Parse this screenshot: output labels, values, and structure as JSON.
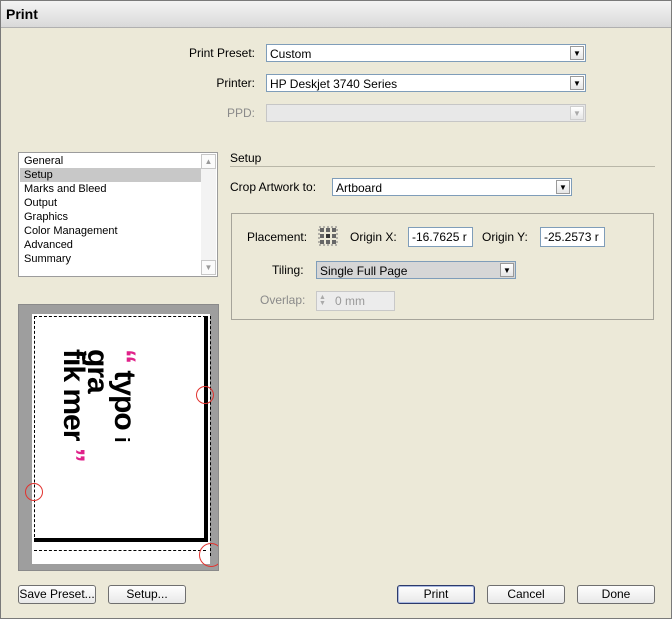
{
  "window": {
    "title": "Print"
  },
  "fields": {
    "print_preset": {
      "label": "Print Preset:",
      "value": "Custom"
    },
    "printer": {
      "label": "Printer:",
      "value": "HP Deskjet 3740 Series"
    },
    "ppd": {
      "label": "PPD:",
      "value": ""
    }
  },
  "sidebar": {
    "items": [
      "General",
      "Setup",
      "Marks and Bleed",
      "Output",
      "Graphics",
      "Color Management",
      "Advanced",
      "Summary"
    ],
    "selected": "Setup"
  },
  "setup": {
    "title": "Setup",
    "crop_artwork": {
      "label": "Crop Artwork to:",
      "value": "Artboard"
    },
    "placement": {
      "label": "Placement:"
    },
    "origin_x": {
      "label": "Origin X:",
      "value": "-16.7625 r"
    },
    "origin_y": {
      "label": "Origin Y:",
      "value": "-25.2573 r"
    },
    "tiling": {
      "label": "Tiling:",
      "value": "Single Full Page"
    },
    "overlap": {
      "label": "Overlap:",
      "value": "0 mm"
    }
  },
  "preview": {
    "artwork_text": [
      "typo",
      "gra",
      "fik",
      "i",
      "mer"
    ],
    "quote_open": "“",
    "quote_close": "”",
    "accent_color": "#e0218a"
  },
  "buttons": {
    "save_preset": "Save Preset...",
    "setup": "Setup...",
    "print": "Print",
    "cancel": "Cancel",
    "done": "Done"
  }
}
